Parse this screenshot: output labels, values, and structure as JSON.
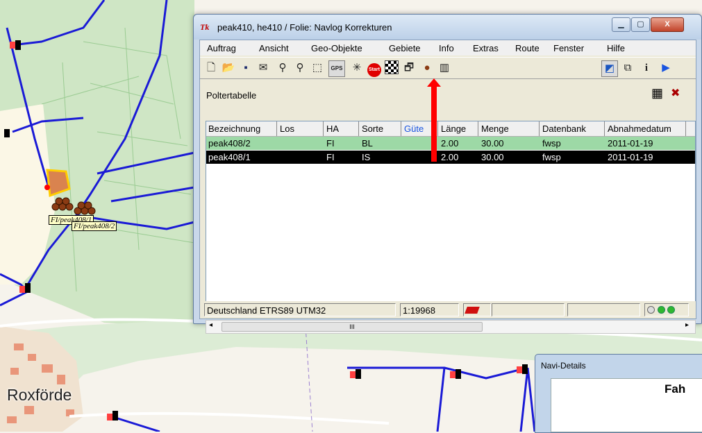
{
  "window": {
    "app_icon": "Tk",
    "title": "peak410, he410 / Folie: Navlog Korrekturen",
    "controls": [
      "minimize-icon",
      "maximize-icon",
      "close-icon"
    ],
    "close_label": "X"
  },
  "menu": [
    "Auftrag",
    "Ansicht",
    "Geo-Objekte",
    "Gebiete",
    "Info",
    "Extras",
    "Route",
    "Fenster",
    "Hilfe"
  ],
  "toolbar_icons": [
    "new-icon",
    "open-folder-icon",
    "save-icon",
    "envelope-icon",
    "zoom-in-icon",
    "zoom-out-icon",
    "select-rect-icon",
    "gps-icon",
    "crosshair-icon",
    "start-icon",
    "checkered-flag-icon",
    "properties-icon",
    "timber-pile-icon",
    "barcode-icon"
  ],
  "toolbar_right_icons": [
    "layer-icon",
    "window-icon",
    "info-icon",
    "play-icon"
  ],
  "toolbar_labels": {
    "gps": "GPS",
    "start": "Start",
    "info": "i"
  },
  "panel": {
    "title": "Poltertabelle",
    "icons": [
      "table-export-icon",
      "pin-icon"
    ]
  },
  "table": {
    "columns": [
      "Bezeichnung",
      "Los",
      "HA",
      "Sorte",
      "Güte",
      "Länge",
      "Menge",
      "Datenbank",
      "Abnahmedatum"
    ],
    "rows": [
      {
        "Bezeichnung": "peak408/2",
        "Los": "",
        "HA": "FI",
        "Sorte": "BL",
        "Güte": "",
        "Länge": "2.00",
        "Menge": "30.00",
        "Datenbank": "fwsp",
        "Abnahmedatum": "2011-01-19",
        "selected": false
      },
      {
        "Bezeichnung": "peak408/1",
        "Los": "",
        "HA": "FI",
        "Sorte": "IS",
        "Güte": "",
        "Länge": "2.00",
        "Menge": "30.00",
        "Datenbank": "fwsp",
        "Abnahmedatum": "2011-01-19",
        "selected": true
      }
    ]
  },
  "scrollbar": {
    "grip": "III"
  },
  "status": {
    "crs": "Deutschland ETRS89 UTM32",
    "scale": "1:19968"
  },
  "navi": {
    "title": "Navi-Details",
    "text": "Fah"
  },
  "map": {
    "place": "Roxförde",
    "labels": [
      "FI/peak408/1",
      "FI/peak408/2"
    ]
  },
  "colors": {
    "selected_row": "#000000",
    "green_row": "#9dd9a6",
    "arrow": "#ff0000",
    "road": "#1a1ad6"
  }
}
